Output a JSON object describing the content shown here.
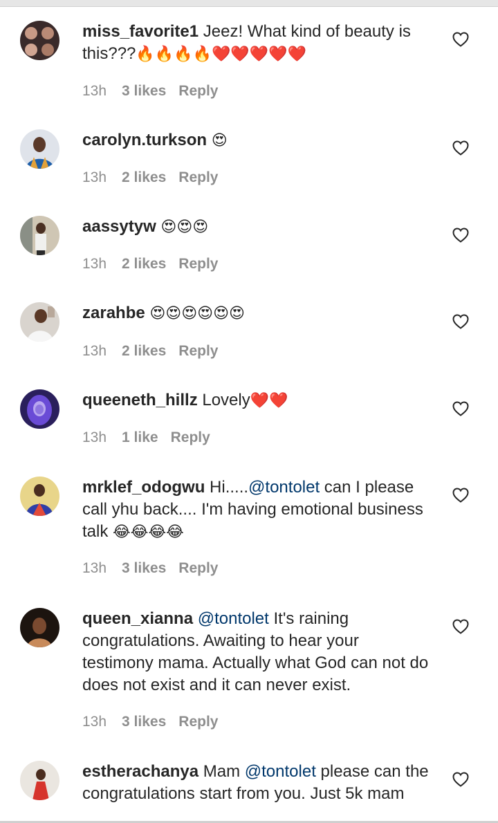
{
  "comments": [
    {
      "user": "miss_favorite1",
      "text": "Jeez! What kind of beauty is this???",
      "emoji": "🔥🔥🔥🔥❤️❤️❤️❤️❤️",
      "time": "13h",
      "likes": "3 likes",
      "reply": "Reply"
    },
    {
      "user": "carolyn.turkson",
      "text": "",
      "emoji": "😍",
      "time": "13h",
      "likes": "2 likes",
      "reply": "Reply"
    },
    {
      "user": "aassytyw",
      "text": "",
      "emoji": "😍😍😍",
      "time": "13h",
      "likes": "2 likes",
      "reply": "Reply"
    },
    {
      "user": "zarahbe",
      "text": "",
      "emoji": "😍😍😍😍😍😍",
      "time": "13h",
      "likes": "2 likes",
      "reply": "Reply"
    },
    {
      "user": "queeneth_hillz",
      "text": "Lovely",
      "emoji": "❤️❤️",
      "time": "13h",
      "likes": "1 like",
      "reply": "Reply"
    },
    {
      "user": "mrklef_odogwu",
      "pre": "Hi.....",
      "mention": "@tontolet",
      "text": " can I please call yhu back.... I'm having emotional business talk",
      "emoji": "😂😂😂😂",
      "time": "13h",
      "likes": "3 likes",
      "reply": "Reply"
    },
    {
      "user": "queen_xianna",
      "mention": "@tontolet",
      "text": " It's raining congratulations. Awaiting to hear your testimony mama. Actually what God can not do does not exist and it can never exist.",
      "emoji": "",
      "time": "13h",
      "likes": "3 likes",
      "reply": "Reply"
    },
    {
      "user": "estherachanya",
      "pre": "Mam ",
      "mention": "@tontolet",
      "text": " please can the congratulations start from you. Just 5k mam",
      "emoji": "",
      "time": "",
      "likes": "",
      "reply": ""
    }
  ],
  "colors": {
    "text": "#262626",
    "meta": "#8e8e8e",
    "mention": "#00376b"
  },
  "icons": {
    "like": "heart-outline-icon"
  }
}
